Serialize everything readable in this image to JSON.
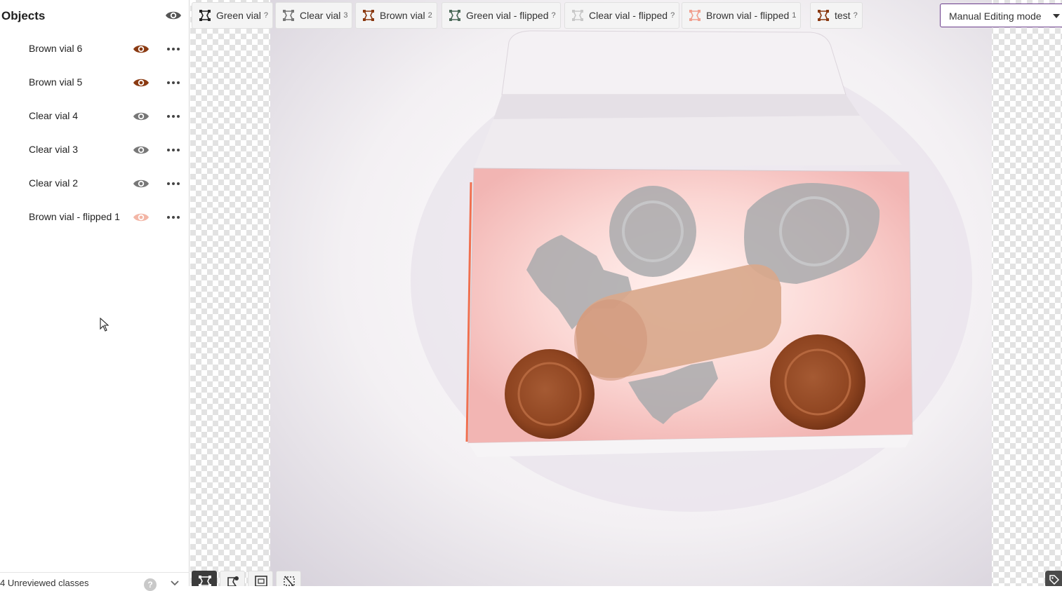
{
  "sidebar": {
    "title": "Objects",
    "objects": [
      {
        "label": "Brown vial 6",
        "eye_color": "#8a3a12"
      },
      {
        "label": "Brown vial 5",
        "eye_color": "#8a3a12"
      },
      {
        "label": "Clear vial 4",
        "eye_color": "#777777"
      },
      {
        "label": "Clear vial 3",
        "eye_color": "#777777"
      },
      {
        "label": "Clear vial 2",
        "eye_color": "#777777"
      },
      {
        "label": "Brown vial - flipped 1",
        "eye_color": "#f3b6a6"
      }
    ],
    "footer_label": "4 Unreviewed classes",
    "help_glyph": "?"
  },
  "classes": [
    {
      "name": "Green vial",
      "count": "?",
      "icon_color": "#222222"
    },
    {
      "name": "Clear vial",
      "count": "3",
      "icon_color": "#777777"
    },
    {
      "name": "Brown vial",
      "count": "2",
      "icon_color": "#8a3a12"
    },
    {
      "name": "Green vial - flipped",
      "count": "?",
      "icon_color": "#4d6b5a"
    },
    {
      "name": "Clear vial - flipped",
      "count": "?",
      "icon_color": "#c8c8c8"
    },
    {
      "name": "Brown vial - flipped",
      "count": "1",
      "icon_color": "#f0a090"
    },
    {
      "name": "test",
      "count": "?",
      "icon_color": "#8a3a12"
    }
  ],
  "mode": {
    "label": "Manual Editing mode"
  },
  "colors": {
    "brown_mask": "#9a4a22",
    "clear_mask": "#a9aaad",
    "flipped_mask": "#d9a88c",
    "accent": "#6a3c8a"
  }
}
